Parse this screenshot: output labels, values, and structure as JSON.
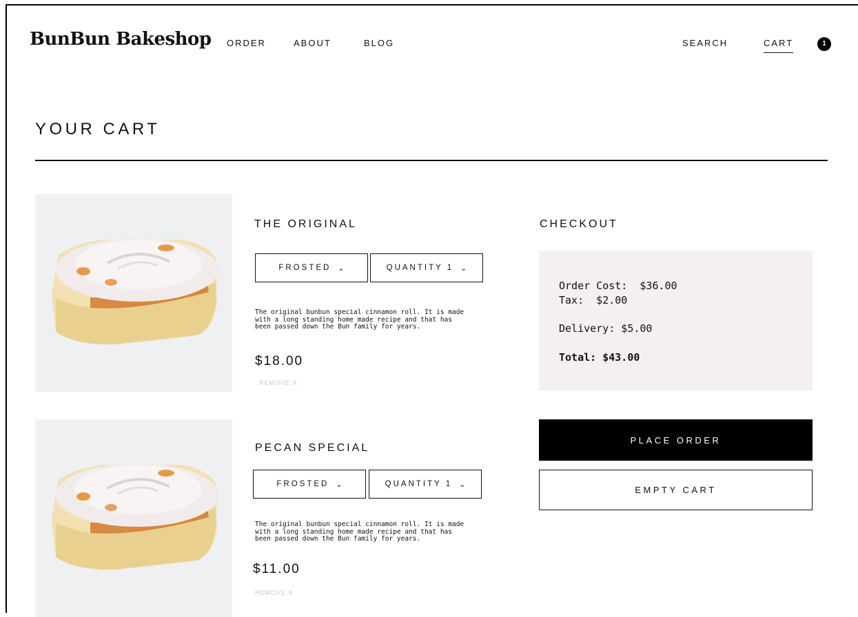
{
  "header": {
    "brand": "BunBun Bakeshop",
    "nav": {
      "order": "ORDER",
      "about": "ABOUT",
      "blog": "BLOG",
      "search": "SEARCH",
      "cart": "CART"
    },
    "cart_count": "1"
  },
  "page_title": "YOUR CART",
  "items": [
    {
      "name": "THE ORIGINAL",
      "style_select": "FROSTED",
      "quantity_select": "QUANTITY 1",
      "description": "The original bunbun special cinnamon roll. It is made with a long standing home made recipe and that has been passed down the Bun family for years.",
      "price": "$18.00",
      "remove": "REMOVE X"
    },
    {
      "name": "PECAN SPECIAL",
      "style_select": "FROSTED",
      "quantity_select": "QUANTITY 1",
      "description": "The original bunbun special cinnamon roll. It is made with a long standing home made recipe and that has been passed down the Bun family for years.",
      "price": "$11.00",
      "remove": "REMOVE X"
    }
  ],
  "checkout": {
    "heading": "CHECKOUT",
    "order_cost": "Order Cost:  $36.00",
    "tax": "Tax:  $2.00",
    "delivery": "Delivery: $5.00",
    "total": "Total: $43.00",
    "place_order": "PLACE ORDER",
    "empty_cart": "EMPTY CART"
  },
  "icons": {
    "chevron": "chevron-down-icon",
    "product_image": "cinnamon-roll-image"
  },
  "colors": {
    "primary": "#000000",
    "image_background": "#eef0f2",
    "summary_background": "#f5f0ef",
    "remove_link": "#d5bfc4"
  }
}
